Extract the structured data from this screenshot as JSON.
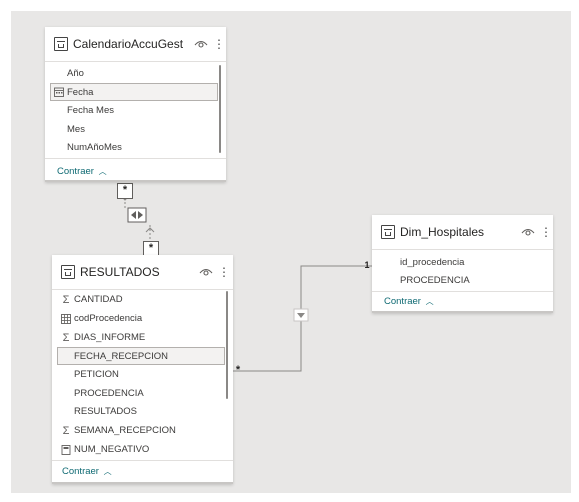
{
  "tables": {
    "calendario": {
      "title": "CalendarioAccuGest",
      "fields": [
        {
          "label": "Año",
          "icon": ""
        },
        {
          "label": "Fecha",
          "icon": "calendar-icon"
        },
        {
          "label": "Fecha Mes",
          "icon": ""
        },
        {
          "label": "Mes",
          "icon": ""
        },
        {
          "label": "NumAñoMes",
          "icon": ""
        }
      ],
      "collapse_label": "Contraer"
    },
    "resultados": {
      "title": "RESULTADOS",
      "fields": [
        {
          "label": "CANTIDAD",
          "icon": "sigma-icon"
        },
        {
          "label": "codProcedencia",
          "icon": "table-grid-icon"
        },
        {
          "label": "DIAS_INFORME",
          "icon": "sigma-icon"
        },
        {
          "label": "FECHA_RECEPCION",
          "icon": ""
        },
        {
          "label": "PETICION",
          "icon": ""
        },
        {
          "label": "PROCEDENCIA",
          "icon": ""
        },
        {
          "label": "RESULTADOS",
          "icon": ""
        },
        {
          "label": "SEMANA_RECEPCION",
          "icon": "sigma-icon"
        },
        {
          "label": "NUM_NEGATIVO",
          "icon": "calculator-icon"
        }
      ],
      "collapse_label": "Contraer"
    },
    "hospitales": {
      "title": "Dim_Hospitales",
      "fields": [
        {
          "label": "id_procedencia",
          "icon": ""
        },
        {
          "label": "PROCEDENCIA",
          "icon": ""
        }
      ],
      "collapse_label": "Contraer"
    }
  },
  "relationships": {
    "calendario_resultados": {
      "from_card": "*",
      "to_card": "*"
    },
    "resultados_hospitales": {
      "many_side": "*",
      "one_side": "1"
    }
  }
}
